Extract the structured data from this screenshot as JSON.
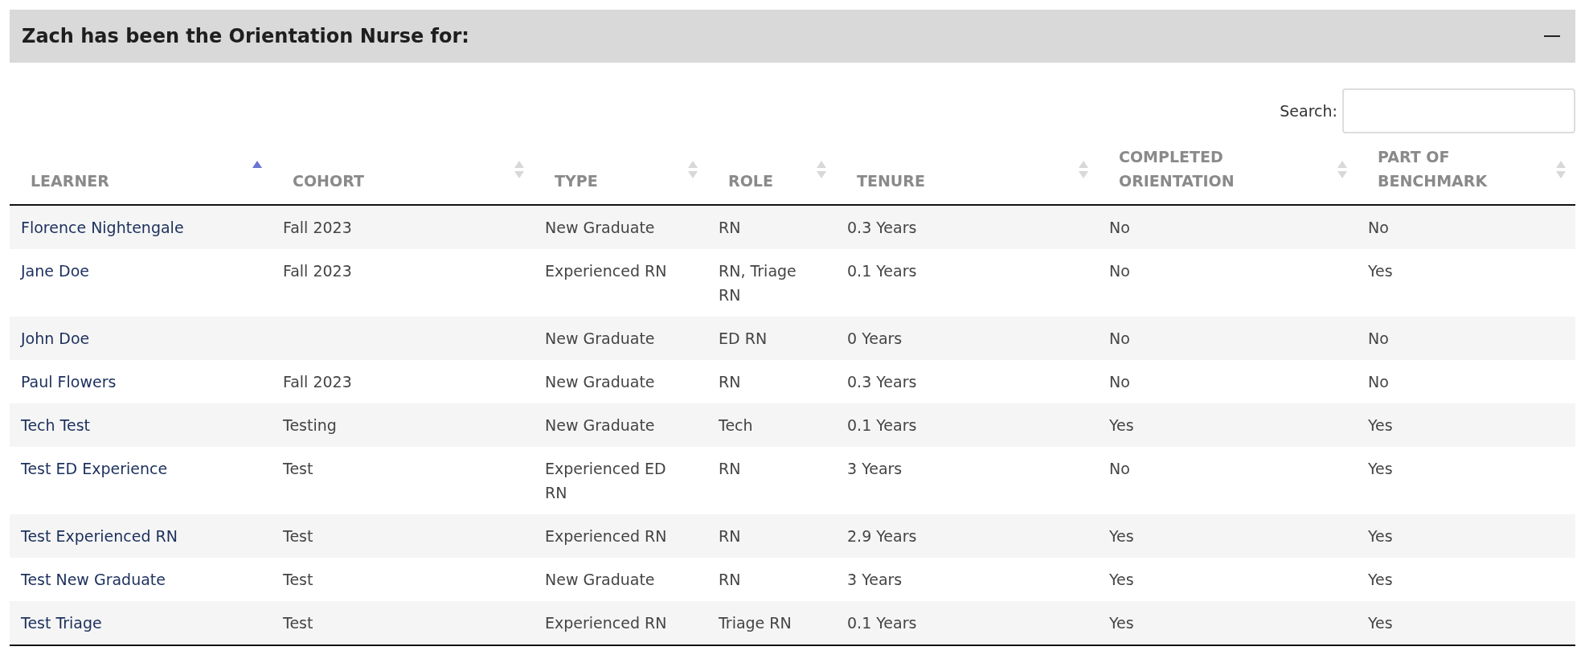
{
  "panel": {
    "title": "Zach has been the Orientation Nurse for:",
    "expanded": true
  },
  "search": {
    "label": "Search:"
  },
  "table": {
    "columns": [
      {
        "label": "LEARNER",
        "sorted": true
      },
      {
        "label": "COHORT",
        "sorted": false
      },
      {
        "label": "TYPE",
        "sorted": false
      },
      {
        "label": "ROLE",
        "sorted": false
      },
      {
        "label": "TENURE",
        "sorted": false
      },
      {
        "label": "COMPLETED ORIENTATION",
        "sorted": false
      },
      {
        "label": "PART OF BENCHMARK",
        "sorted": false
      }
    ],
    "rows": [
      [
        "Florence Nightengale",
        "Fall 2023",
        "New Graduate",
        "RN",
        "0.3 Years",
        "No",
        "No"
      ],
      [
        "Jane Doe",
        "Fall 2023",
        "Experienced RN",
        "RN, Triage RN",
        "0.1 Years",
        "No",
        "Yes"
      ],
      [
        "John Doe",
        "",
        "New Graduate",
        "ED RN",
        "0 Years",
        "No",
        "No"
      ],
      [
        "Paul Flowers",
        "Fall 2023",
        "New Graduate",
        "RN",
        "0.3 Years",
        "No",
        "No"
      ],
      [
        "Tech Test",
        "Testing",
        "New Graduate",
        "Tech",
        "0.1 Years",
        "Yes",
        "Yes"
      ],
      [
        "Test ED Experience",
        "Test",
        "Experienced ED RN",
        "RN",
        "3 Years",
        "No",
        "Yes"
      ],
      [
        "Test Experienced RN",
        "Test",
        "Experienced RN",
        "RN",
        "2.9 Years",
        "Yes",
        "Yes"
      ],
      [
        "Test New Graduate",
        "Test",
        "New Graduate",
        "RN",
        "3 Years",
        "Yes",
        "Yes"
      ],
      [
        "Test Triage",
        "Test",
        "Experienced RN",
        "Triage RN",
        "0.1 Years",
        "Yes",
        "Yes"
      ]
    ]
  }
}
